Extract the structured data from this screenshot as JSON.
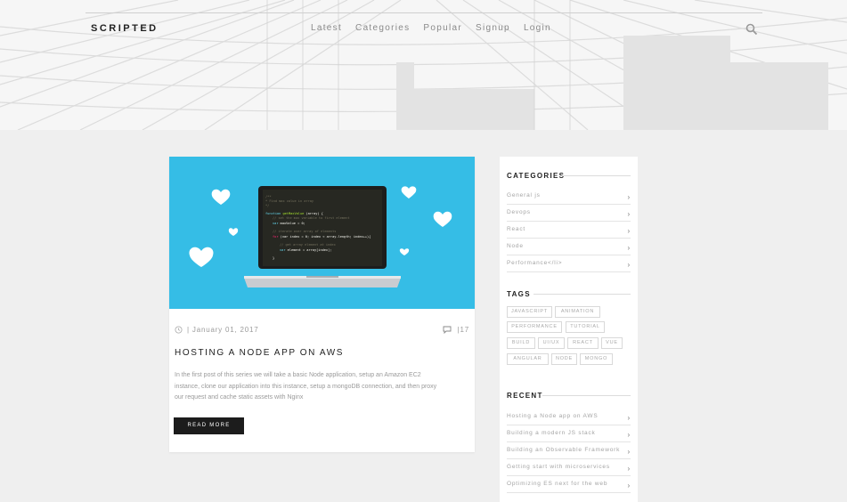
{
  "header": {
    "brand": "SCRIPTED",
    "nav": [
      "Latest",
      "Categories",
      "Popular",
      "Signup",
      "Login"
    ]
  },
  "post": {
    "date": "January 01, 2017",
    "comments": "17",
    "title": "HOSTING A NODE APP ON AWS",
    "excerpt": "In the first post of this series we will take a basic Node application, setup an Amazon EC2 instance, clone our application into this instance, setup a mongoDB connection, and then proxy our request and cache static assets with Nginx",
    "read_more": "READ MORE"
  },
  "sidebar": {
    "categories_title": "CATEGORIES",
    "categories": [
      "General js",
      "Devops",
      "React",
      "Node",
      "Performance</li>"
    ],
    "tags_title": "TAGS",
    "tags": [
      "JAVASCRIPT",
      "ANIMATION",
      "PERFORMANCE",
      "TUTORIAL",
      "BUILD",
      "UI/UX",
      "REACT",
      "VUE",
      "ANGULAR",
      "NODE",
      "MONGO"
    ],
    "recent_title": "RECENT",
    "recent": [
      "Hosting a Node app on AWS",
      "Building a modern JS stack",
      "Building an Observable Framework",
      "Getting start with microservices",
      "Optimizing ES next for the web"
    ]
  },
  "colors": {
    "hero_bg": "#f6f6f6",
    "card_image_bg": "#35bde6",
    "button_bg": "#1c1c1c"
  }
}
